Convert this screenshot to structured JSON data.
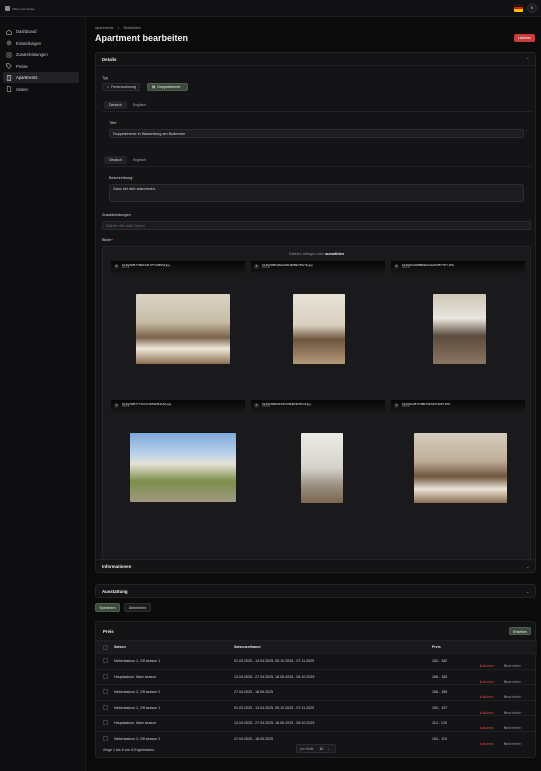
{
  "app": {
    "logo_text": "Villa Luisa Suites"
  },
  "header": {
    "avatar_initial": "E",
    "flag_colors": [
      "#1a1a1a",
      "#d21e1e",
      "#f2c200"
    ]
  },
  "sidebar": {
    "items": [
      {
        "label": "Dashboard",
        "icon": "home-icon"
      },
      {
        "label": "Einstellungen",
        "icon": "gear-icon"
      },
      {
        "label": "Zusatzleistungen",
        "icon": "sparkle-icon"
      },
      {
        "label": "Preise",
        "icon": "tag-icon"
      },
      {
        "label": "Apartments",
        "icon": "building-icon",
        "active": true
      },
      {
        "label": "Seiten",
        "icon": "document-icon"
      }
    ]
  },
  "breadcrumb": {
    "root": "Apartments",
    "sep": ">",
    "current": "Bearbeiten"
  },
  "page": {
    "title": "Apartment bearbeiten",
    "delete_label": "Löschen"
  },
  "details": {
    "title": "Details",
    "typ_label": "Typ",
    "typ_options": [
      "Ferienwohnung",
      "Doppelzimmer"
    ],
    "typ_selected": "Doppelzimmer",
    "lang_tabs": [
      "Deutsch",
      "Englisch"
    ],
    "titel_label": "Titel",
    "titel_value": "Doppelzimmer in Wasserburg am Bodensee",
    "beschreibung_label": "Beschreibung",
    "beschreibung_value": "Ganz bei dich ankommen.",
    "zusatz_label": "Zusatzleistungen",
    "zusatz_placeholder": "Wählen Sie eine Option",
    "bilder_label": "Bilder",
    "upload_hint_pre": "Dateien ablegen oder ",
    "upload_hint_link": "auswählen",
    "images": [
      {
        "name": "01JNVWB7Y8EP4JKYPTC0BVW.jpg",
        "size": "112 KB"
      },
      {
        "name": "01JNVWBGRFAA5FH9KBEYBGYE.jpg",
        "size": "203 KB"
      },
      {
        "name": "01JNNCJADBBDEHC3AWVBYTPY.JPG",
        "size": "286 KB"
      },
      {
        "name": "01JNVWB7Y7TACU4DSWSHGSA.jpg",
        "size": "252 KB"
      },
      {
        "name": "01JNVWBD2FKRYD5HPNRTDC3.jpg",
        "size": "178 KB"
      },
      {
        "name": "01JNNCJBTV4BET9PG9YHRFT.JPG",
        "size": "338 KB"
      }
    ]
  },
  "informationen": {
    "title": "Informationen"
  },
  "ausstattung": {
    "title": "Ausstattung"
  },
  "form_actions": {
    "save": "Speichern",
    "cancel": "Abbrechen"
  },
  "preis": {
    "title": "Preis",
    "create_label": "Erstellen",
    "columns": [
      "Saison",
      "Saisonzeitraum",
      "Preis"
    ],
    "rows": [
      {
        "saison": "Nebensaison 1, Off season 1",
        "zeitraum": "01.03.2025 - 13.04.2025, 05.10.2025 - 07.11.2025",
        "preis": "152 - 162"
      },
      {
        "saison": "Hauptsaison, Main season",
        "zeitraum": "13.04.2025 - 27.04.2025, 18.05.2025 - 05.10.2025",
        "preis": "168 - 183"
      },
      {
        "saison": "Nebensaison 2, Off season 2",
        "zeitraum": "27.04.2025 - 18.05.2025",
        "preis": "158 - 169"
      },
      {
        "saison": "Nebensaison 1, Off season 1",
        "zeitraum": "01.03.2025 - 13.04.2025, 05.10.2025 - 07.11.2025",
        "preis": "100 - 107"
      },
      {
        "saison": "Hauptsaison, Main season",
        "zeitraum": "13.04.2025 - 27.04.2025, 18.05.2025 - 05.10.2025",
        "preis": "113 - 120"
      },
      {
        "saison": "Nebensaison 2, Off season 2",
        "zeitraum": "27.04.2025 - 18.05.2025",
        "preis": "103 - 110"
      }
    ],
    "delete_label": "Löschen",
    "edit_label": "Bearbeiten",
    "footer_text": "Zeige 1 bis 6 von 6 Ergebnissen",
    "per_page_label": "pro Seite",
    "per_page_value": "10"
  }
}
